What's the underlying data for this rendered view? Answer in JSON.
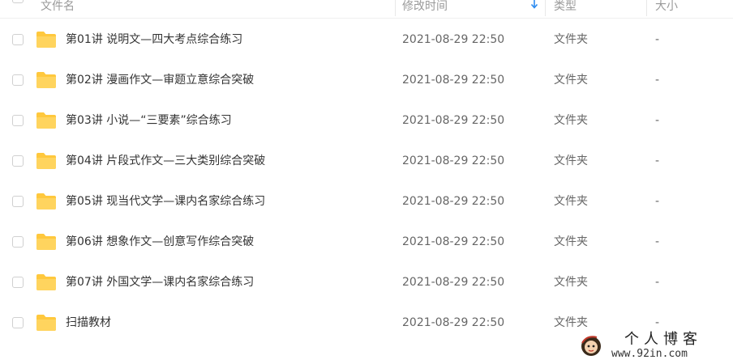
{
  "header": {
    "name_label": "文件名",
    "time_label": "修改时间",
    "type_label": "类型",
    "size_label": "大小"
  },
  "files": [
    {
      "name": "第01讲 说明文—四大考点综合练习",
      "time": "2021-08-29 22:50",
      "type": "文件夹",
      "size": "-"
    },
    {
      "name": "第02讲 漫画作文—审题立意综合突破",
      "time": "2021-08-29 22:50",
      "type": "文件夹",
      "size": "-"
    },
    {
      "name": "第03讲 小说—“三要素”综合练习",
      "time": "2021-08-29 22:50",
      "type": "文件夹",
      "size": "-"
    },
    {
      "name": "第04讲 片段式作文—三大类别综合突破",
      "time": "2021-08-29 22:50",
      "type": "文件夹",
      "size": "-"
    },
    {
      "name": "第05讲 现当代文学—课内名家综合练习",
      "time": "2021-08-29 22:50",
      "type": "文件夹",
      "size": "-"
    },
    {
      "name": "第06讲 想象作文—创意写作综合突破",
      "time": "2021-08-29 22:50",
      "type": "文件夹",
      "size": "-"
    },
    {
      "name": "第07讲 外国文学—课内名家综合练习",
      "time": "2021-08-29 22:50",
      "type": "文件夹",
      "size": "-"
    },
    {
      "name": "扫描教材",
      "time": "2021-08-29 22:50",
      "type": "文件夹",
      "size": "-"
    }
  ],
  "watermark": {
    "title": "个人博客",
    "url": "www.92in.com"
  },
  "colors": {
    "folder": "#ffc83d",
    "accent": "#2e8cf0"
  }
}
